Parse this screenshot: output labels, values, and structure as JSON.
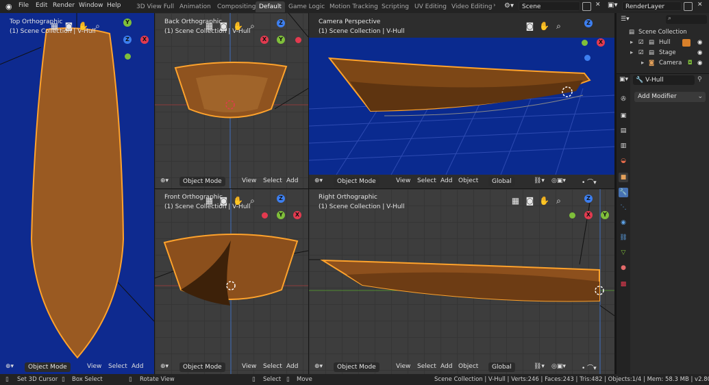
{
  "menu": {
    "file": "File",
    "edit": "Edit",
    "render": "Render",
    "window": "Window",
    "help": "Help"
  },
  "workspaces": [
    "3D View Full",
    "Animation",
    "Compositing",
    "Default",
    "Game Logic",
    "Motion Tracking",
    "Scripting",
    "UV Editing",
    "Video Editing"
  ],
  "active_workspace": "Default",
  "scene_field": "Scene",
  "renderlayer_field": "RenderLayer",
  "viewports": {
    "top_ortho": {
      "title": "Top Orthographic",
      "sub": "(1) Scene Collection | V-Hull"
    },
    "back_ortho": {
      "title": "Back Orthographic",
      "sub": "(1) Scene Collection | V-Hull"
    },
    "camera_persp": {
      "title": "Camera Perspective",
      "sub": "(1) Scene Collection | V-Hull"
    },
    "front_ortho": {
      "title": "Front Orthographic",
      "sub": "(1) Scene Collection | V-Hull"
    },
    "right_ortho": {
      "title": "Right Orthographic",
      "sub": "(1) Scene Collection | V-Hull"
    }
  },
  "viewport_footer": {
    "mode": "Object Mode",
    "view": "View",
    "select": "Select",
    "add": "Add",
    "object": "Object",
    "transform": "Global"
  },
  "outliner": {
    "root": "Scene Collection",
    "items": [
      {
        "label": "Hull"
      },
      {
        "label": "Stage"
      },
      {
        "label": "Camera"
      }
    ]
  },
  "properties": {
    "object_name": "V-Hull",
    "add_modifier": "Add Modifier"
  },
  "status": {
    "left1": "Set 3D Cursor",
    "left2": "Box Select",
    "left3": "Rotate View",
    "mid1": "Select",
    "mid2": "Move",
    "right": "Scene Collection | V-Hull | Verts:246 | Faces:243 | Tris:482 | Objects:1/4 | Mem: 58.3 MB | v2.80.75"
  },
  "colors": {
    "accent": "#4772b3",
    "hull": "#8a4f1c",
    "outline": "#ffa32c",
    "blue_bg": "#0f2a8c"
  }
}
